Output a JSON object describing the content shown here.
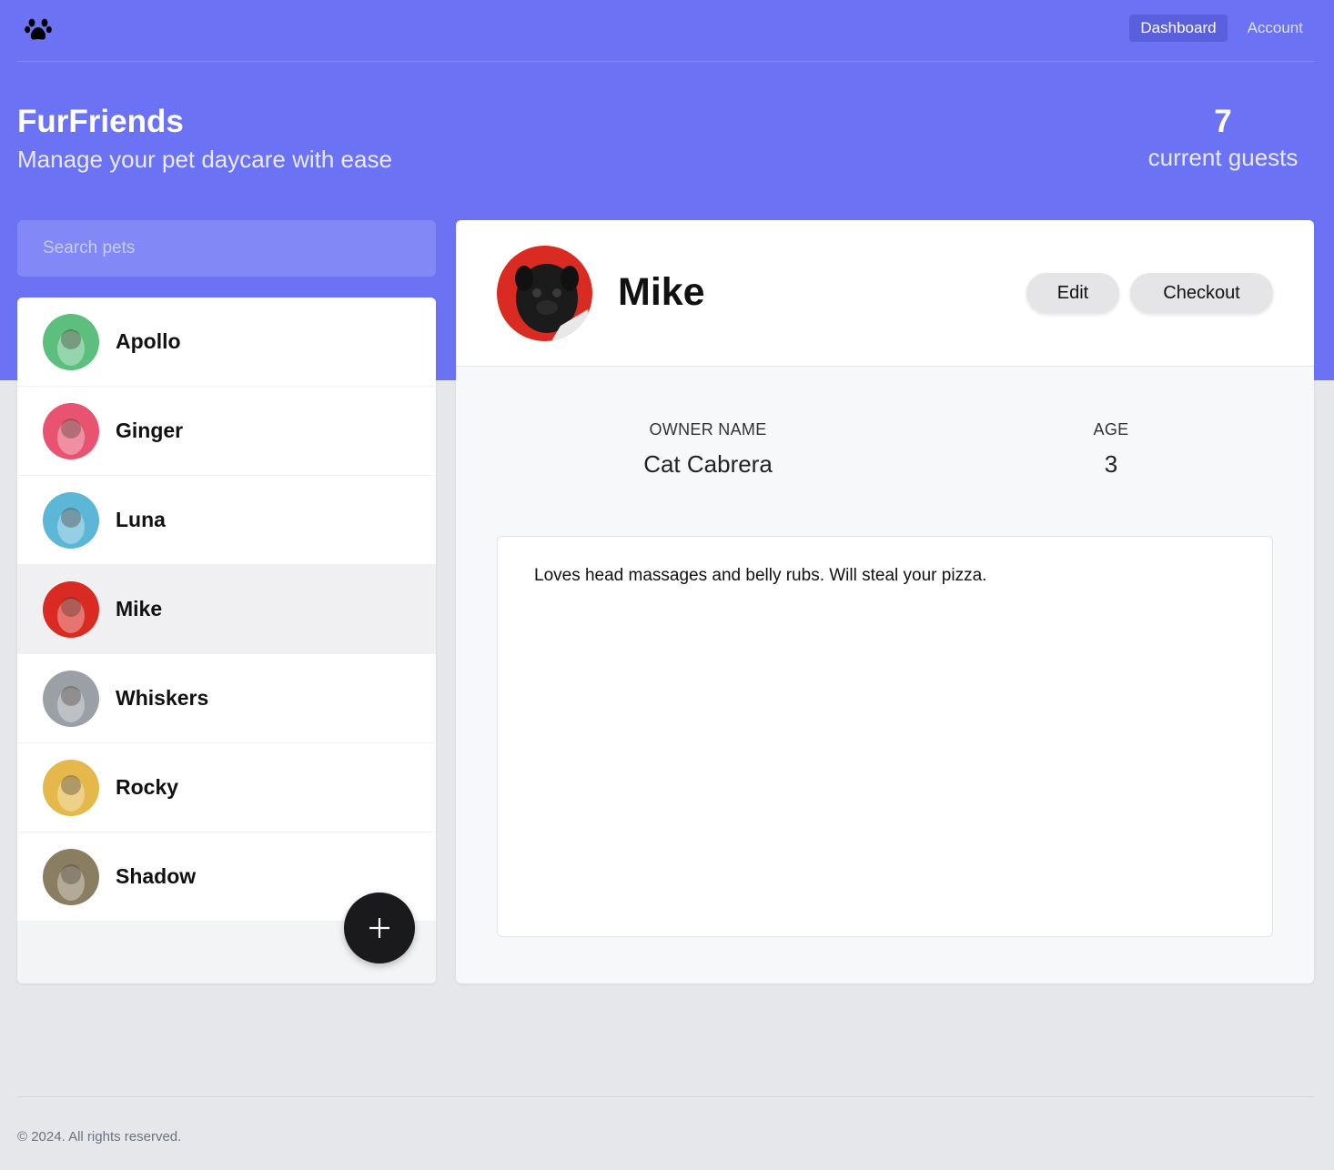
{
  "nav": {
    "logo_icon": "paw-icon",
    "links": [
      "Dashboard",
      "Account"
    ]
  },
  "brand": {
    "title": "FurFriends",
    "subtitle": "Manage your pet daycare with ease"
  },
  "stats": {
    "guest_count": "7",
    "guest_label": "current guests"
  },
  "search": {
    "placeholder": "Search pets"
  },
  "pets": [
    {
      "name": "Apollo",
      "color": "#5cbf7e"
    },
    {
      "name": "Ginger",
      "color": "#e8546f"
    },
    {
      "name": "Luna",
      "color": "#5cb6d6"
    },
    {
      "name": "Mike",
      "color": "#d92b22"
    },
    {
      "name": "Whiskers",
      "color": "#9aa0a6"
    },
    {
      "name": "Rocky",
      "color": "#e4b84a"
    },
    {
      "name": "Shadow",
      "color": "#8a7e62"
    }
  ],
  "selected": {
    "name": "Mike",
    "edit_label": "Edit",
    "checkout_label": "Checkout",
    "owner_label": "OWNER NAME",
    "owner_value": "Cat Cabrera",
    "age_label": "AGE",
    "age_value": "3",
    "notes": "Loves head massages and belly rubs. Will steal your pizza."
  },
  "footer": {
    "text": "© 2024. All rights reserved."
  },
  "colors": {
    "accent": "#6b73f4",
    "fab": "#1a1a1d"
  }
}
